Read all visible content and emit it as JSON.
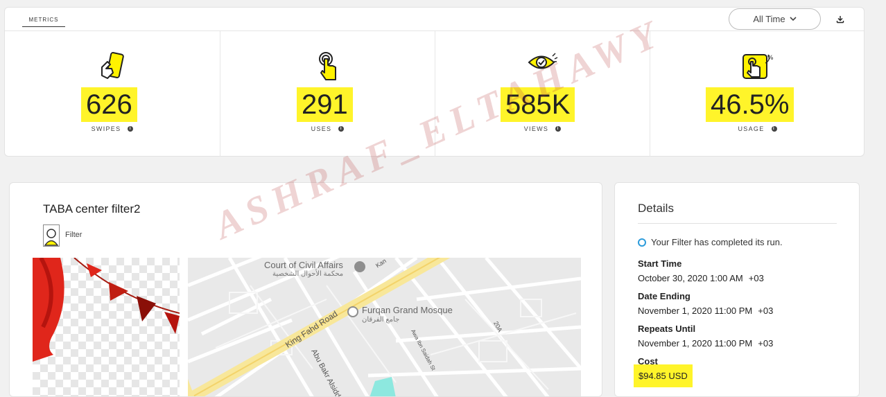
{
  "metrics": {
    "tab_label": "METRICS",
    "range_selector": "All Time",
    "stats": [
      {
        "value": "626",
        "label": "SWIPES",
        "icon": "swipe-phone-icon"
      },
      {
        "value": "291",
        "label": "USES",
        "icon": "tap-hand-icon"
      },
      {
        "value": "585K",
        "label": "VIEWS",
        "icon": "eye-check-icon"
      },
      {
        "value": "46.5%",
        "label": "USAGE",
        "icon": "percent-tap-icon"
      }
    ]
  },
  "filter": {
    "name": "TABA center filter2",
    "type_label": "Filter",
    "map": {
      "labels": {
        "court": "Court of Civil Affairs",
        "court_ar": "محكمة الأحوال الشخصية",
        "mosque": "Furqan Grand Mosque",
        "mosque_ar": "جامع الفرقان",
        "king_fahd": "King Fahd Road",
        "abu_bakr": "Abu Bakr Alsidd",
        "awa_saidah": "Awa Ibn Saidah St",
        "road_20a": "20A",
        "kan": "Kan"
      }
    }
  },
  "details": {
    "title": "Details",
    "status": "Your Filter has completed its run.",
    "start_label": "Start Time",
    "start_value": "October 30, 2020 1:00 AM",
    "start_tz": "+03",
    "end_label": "Date Ending",
    "end_value": "November 1, 2020 11:00 PM",
    "end_tz": "+03",
    "repeat_label": "Repeats Until",
    "repeat_value": "November 1, 2020 11:00 PM",
    "repeat_tz": "+03",
    "cost_label": "Cost",
    "cost_value": "$94.85 USD"
  },
  "watermark": "ASHRAF_ELTAHAWY",
  "colors": {
    "highlight": "#fff42a",
    "status_ring": "#2d9cdb",
    "icon_yellow": "#fff200"
  }
}
